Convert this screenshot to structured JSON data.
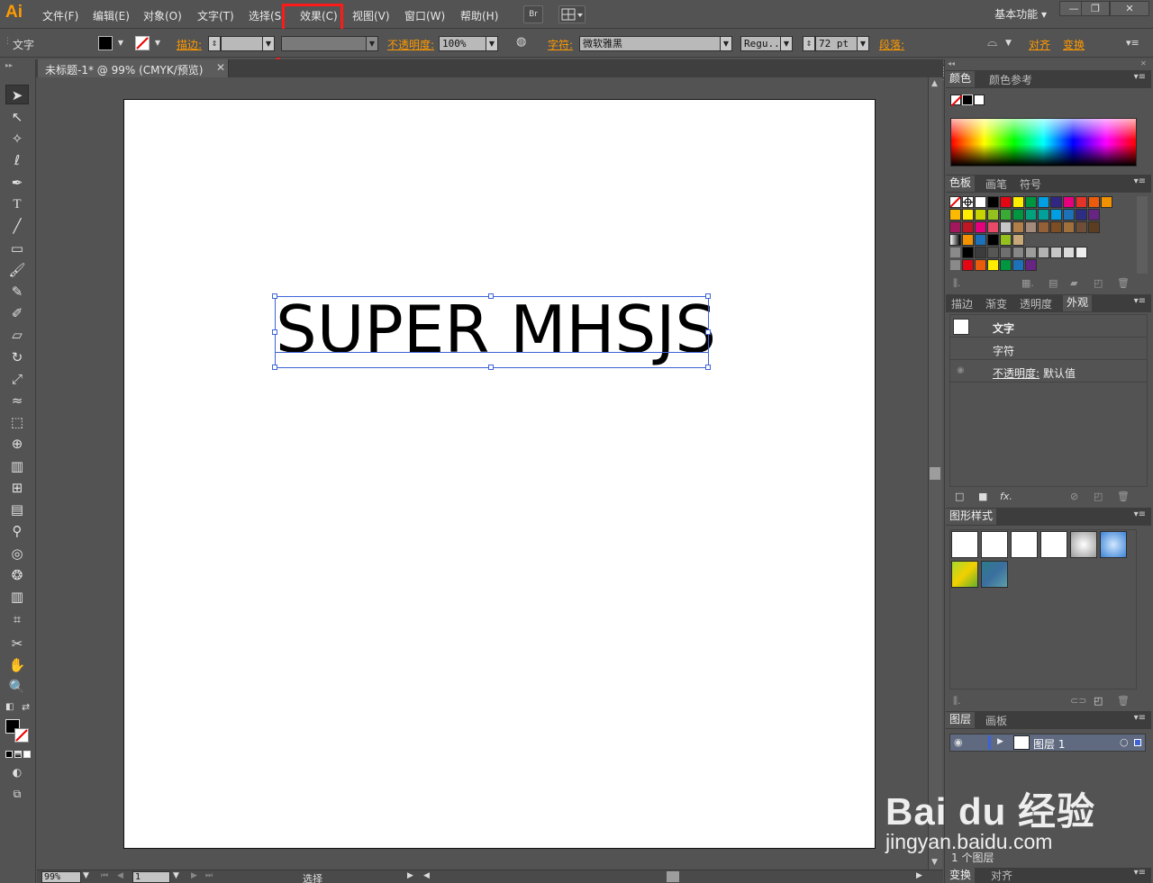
{
  "app": {
    "logo": "Ai"
  },
  "menu": {
    "items": [
      "文件(F)",
      "编辑(E)",
      "对象(O)",
      "文字(T)",
      "选择(S",
      "效果(C)",
      "视图(V)",
      "窗口(W)",
      "帮助(H)"
    ],
    "bridge_button": "Br",
    "workspace": "基本功能",
    "highlighted_item": "效果(C)"
  },
  "control_bar": {
    "type_label": "文字",
    "stroke_label": "描边:",
    "opacity_label": "不透明度:",
    "opacity_value": "100%",
    "character_label": "字符:",
    "font_family": "微软雅黑",
    "font_style": "Regu...",
    "font_size": "72 pt",
    "paragraph_label": "段落:",
    "align_label": "对齐",
    "transform_label": "变换"
  },
  "document": {
    "tab_title": "未标题-1* @ 99% (CMYK/预览)",
    "close_glyph": "✕",
    "artboard_text": "SUPER MHSJS"
  },
  "status": {
    "zoom": "99%",
    "artboard_number": "1",
    "tool_text": "选择"
  },
  "panels": {
    "color": {
      "tabs": [
        "颜色",
        "颜色参考"
      ]
    },
    "swatches": {
      "tabs": [
        "色板",
        "画笔",
        "符号"
      ]
    },
    "appearance": {
      "tabs": [
        "描边",
        "渐变",
        "透明度",
        "外观"
      ],
      "object_label": "文字",
      "row_character": "字符",
      "opacity_label": "不透明度:",
      "opacity_value": "默认值"
    },
    "graphic_styles": {
      "tabs": [
        "图形样式"
      ]
    },
    "layers": {
      "tabs": [
        "图层",
        "画板"
      ],
      "layer_name": "图层 1",
      "count_text": "1 个图层"
    },
    "bottom": {
      "tabs": [
        "变换",
        "对齐"
      ]
    }
  },
  "colors": {
    "ui_bg": "#535353",
    "accent_orange": "#ff9a00",
    "selection_blue": "#3d63d8",
    "highlight_red": "#ff1a1a"
  },
  "watermark": {
    "logo": "Bai du 经验",
    "url": "jingyan.baidu.com"
  }
}
